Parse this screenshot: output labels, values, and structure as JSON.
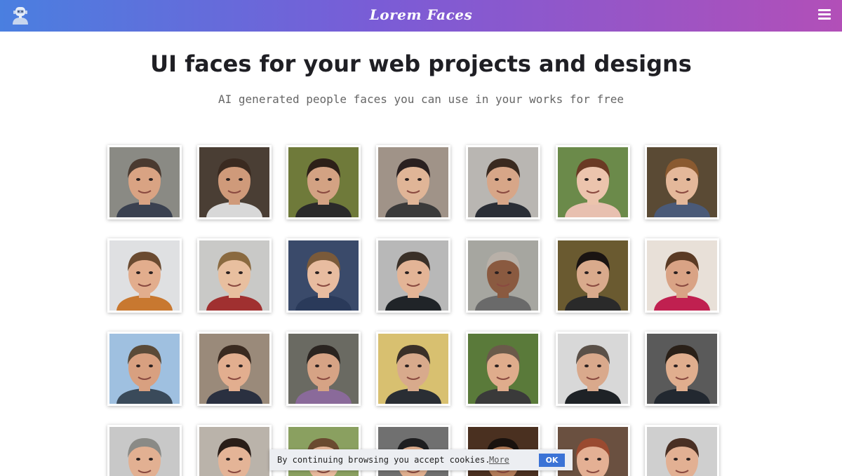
{
  "header": {
    "brand": "Lorem Faces",
    "logo_icon": "robot-avatar-icon",
    "menu_icon": "hamburger-menu-icon",
    "gradient": [
      "#4a7fe0",
      "#7a5cd6",
      "#b24fb8"
    ]
  },
  "hero": {
    "title": "UI faces for your web projects and designs",
    "subtitle": "AI generated people faces you can use in your works for free"
  },
  "faces": [
    {
      "bg": "#8a8a84",
      "skin": "#d9a383",
      "hair": "#4a3a30",
      "shirt": "#3a4150"
    },
    {
      "bg": "#4a3e34",
      "skin": "#cf9a7a",
      "hair": "#3a2a20",
      "shirt": "#d8d8d8"
    },
    {
      "bg": "#6f7a3a",
      "skin": "#d3a283",
      "hair": "#2d2018",
      "shirt": "#2a2a2a"
    },
    {
      "bg": "#a09388",
      "skin": "#e0b597",
      "hair": "#2a2020",
      "shirt": "#3a3a3a"
    },
    {
      "bg": "#b9b6b2",
      "skin": "#d7a688",
      "hair": "#3a2a20",
      "shirt": "#2a2e36"
    },
    {
      "bg": "#6b8a4a",
      "skin": "#ecc4ad",
      "hair": "#6a3a24",
      "shirt": "#e8c0b0"
    },
    {
      "bg": "#5a4a34",
      "skin": "#e4b89a",
      "hair": "#8a5a30",
      "shirt": "#4a5a78"
    },
    {
      "bg": "#dfe0e2",
      "skin": "#e2ad8d",
      "hair": "#6a4a30",
      "shirt": "#c87830"
    },
    {
      "bg": "#c9c9c7",
      "skin": "#e8bf9f",
      "hair": "#8a6a40",
      "shirt": "#a03030"
    },
    {
      "bg": "#3a4a6a",
      "skin": "#e8bca0",
      "hair": "#7a5a3a",
      "shirt": "#2a3a5a"
    },
    {
      "bg": "#b8b8b8",
      "skin": "#e3b496",
      "hair": "#3a3028",
      "shirt": "#202428"
    },
    {
      "bg": "#a6a6a0",
      "skin": "#8a5a40",
      "hair": "#b8b0a8",
      "shirt": "#6a6a6a"
    },
    {
      "bg": "#6a5a30",
      "skin": "#d9aa8c",
      "hair": "#1a1412",
      "shirt": "#2a2a2a"
    },
    {
      "bg": "#e8e0d8",
      "skin": "#d9a385",
      "hair": "#5a3a24",
      "shirt": "#c02050"
    },
    {
      "bg": "#9fc0e0",
      "skin": "#d8a080",
      "hair": "#5a4a38",
      "shirt": "#3a4a5a"
    },
    {
      "bg": "#9a8a7a",
      "skin": "#e2ae8f",
      "hair": "#3a2a20",
      "shirt": "#2a3040"
    },
    {
      "bg": "#6a6a62",
      "skin": "#d6a385",
      "hair": "#2a2420",
      "shirt": "#8a6a9a"
    },
    {
      "bg": "#d8c070",
      "skin": "#d8aa8c",
      "hair": "#3a3028",
      "shirt": "#2a2e34"
    },
    {
      "bg": "#5a7a3a",
      "skin": "#dfac8c",
      "hair": "#6a5a4a",
      "shirt": "#3a3a3a"
    },
    {
      "bg": "#d8d8d8",
      "skin": "#d9a98c",
      "hair": "#5a5048",
      "shirt": "#1e2226"
    },
    {
      "bg": "#5a5a5a",
      "skin": "#e0ae8e",
      "hair": "#2a2018",
      "shirt": "#222830"
    },
    {
      "bg": "#c8c8c8",
      "skin": "#e2b092",
      "hair": "#8a8a86",
      "shirt": "#4a5a6a"
    },
    {
      "bg": "#bab3aa",
      "skin": "#e4b497",
      "hair": "#2a1e18",
      "shirt": "#3a3a3a"
    },
    {
      "bg": "#8aa060",
      "skin": "#e8b99c",
      "hair": "#6a4a30",
      "shirt": "#4a4a4a"
    },
    {
      "bg": "#707070",
      "skin": "#dfae8e",
      "hair": "#1e1e20",
      "shirt": "#2a2a2a"
    },
    {
      "bg": "#4a3020",
      "skin": "#b07a58",
      "hair": "#1a120e",
      "shirt": "#3a2a20"
    },
    {
      "bg": "#6a5040",
      "skin": "#e4b094",
      "hair": "#9a4a30",
      "shirt": "#3a3a40"
    },
    {
      "bg": "#cfcfcf",
      "skin": "#e2b093",
      "hair": "#4a3024",
      "shirt": "#3a4a5a"
    }
  ],
  "cookie": {
    "text": "By continuing browsing you accept cookies.",
    "more_label": "More",
    "ok_label": "OK",
    "button_color": "#3b73d6"
  }
}
